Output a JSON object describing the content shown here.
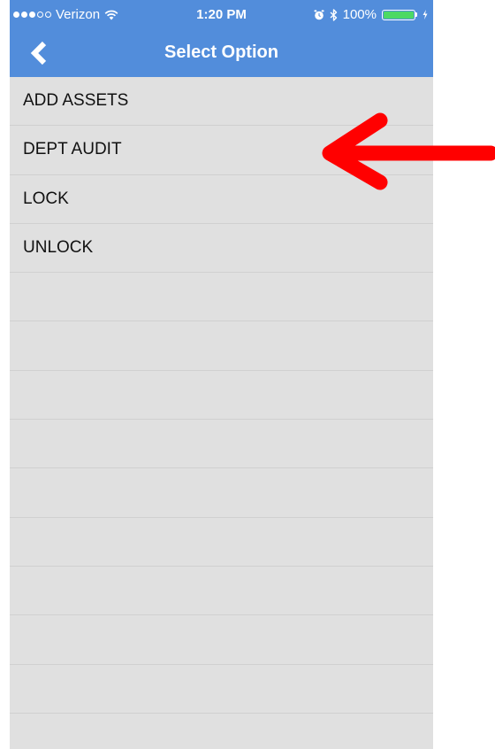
{
  "status_bar": {
    "carrier": "Verizon",
    "signal_bars_filled": 3,
    "signal_bars_total": 5,
    "time": "1:20 PM",
    "battery_text": "100%",
    "battery_level": 1.0,
    "icons": [
      "wifi-icon",
      "alarm-icon",
      "bluetooth-icon",
      "battery-icon",
      "charging-icon"
    ]
  },
  "nav": {
    "back_icon": "chevron-left-icon",
    "title": "Select Option"
  },
  "options": [
    {
      "label": "ADD ASSETS"
    },
    {
      "label": "DEPT AUDIT"
    },
    {
      "label": "LOCK"
    },
    {
      "label": "UNLOCK"
    },
    {
      "label": ""
    },
    {
      "label": ""
    },
    {
      "label": ""
    },
    {
      "label": ""
    },
    {
      "label": ""
    },
    {
      "label": ""
    },
    {
      "label": ""
    },
    {
      "label": ""
    },
    {
      "label": ""
    },
    {
      "label": ""
    }
  ],
  "annotation": {
    "type": "arrow",
    "points_to": "DEPT AUDIT",
    "color": "#ff0000"
  },
  "colors": {
    "accent": "#528ddb",
    "list_background": "#e0e0e0",
    "battery_fill": "#4cd964"
  }
}
